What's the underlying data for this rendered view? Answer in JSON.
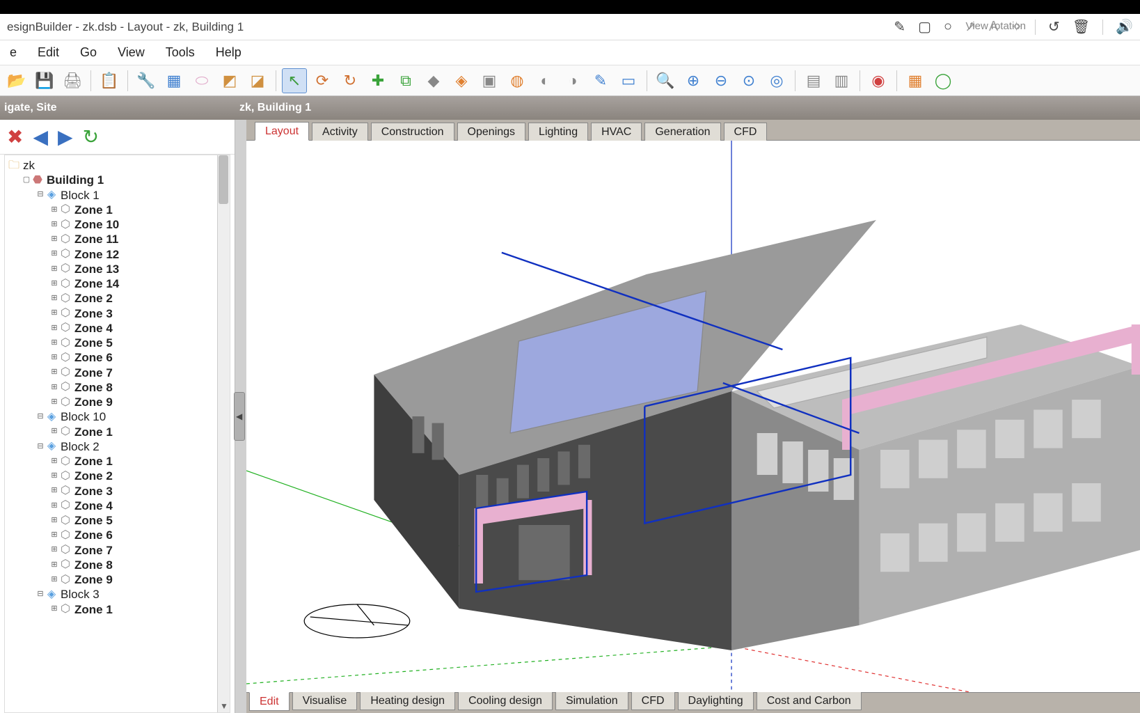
{
  "app": {
    "title_text": "esignBuilder - zk.dsb - Layout - zk, Building 1"
  },
  "menubar": {
    "items": [
      {
        "label": "e"
      },
      {
        "label": "Edit"
      },
      {
        "label": "Go"
      },
      {
        "label": "View"
      },
      {
        "label": "Tools"
      },
      {
        "label": "Help"
      }
    ]
  },
  "title_tools": {
    "items": [
      {
        "glyph": "✎",
        "name": "pencil-icon"
      },
      {
        "glyph": "▢",
        "name": "square-icon"
      },
      {
        "glyph": "○",
        "name": "circle-icon"
      },
      {
        "glyph": "↗",
        "name": "arrow-icon"
      },
      {
        "glyph": "A",
        "name": "text-icon"
      },
      {
        "glyph": "✧",
        "name": "sparkle-icon"
      },
      {
        "glyph": "↺",
        "name": "undo-icon"
      },
      {
        "glyph": "🗑",
        "name": "trash-icon"
      },
      {
        "glyph": "🔊",
        "name": "speaker-icon"
      }
    ]
  },
  "view_hint": {
    "text": "View rotation"
  },
  "toolbar": {
    "buttons": [
      {
        "glyph": "📂",
        "name": "open-icon",
        "cls": "c-folder"
      },
      {
        "glyph": "💾",
        "name": "save-icon",
        "cls": "c-save"
      },
      {
        "glyph": "🖨",
        "name": "print-icon",
        "cls": "c-print"
      },
      {
        "glyph": "sep"
      },
      {
        "glyph": "📋",
        "name": "clipboard-icon",
        "cls": "c-grey"
      },
      {
        "glyph": "sep"
      },
      {
        "glyph": "🔧",
        "name": "wrench-icon",
        "cls": "c-wrench"
      },
      {
        "glyph": "▦",
        "name": "grid-icon",
        "cls": "c-blue"
      },
      {
        "glyph": "⬭",
        "name": "eraser-icon",
        "cls": "c-erase"
      },
      {
        "glyph": "◩",
        "name": "block-add-icon",
        "cls": "c-cube"
      },
      {
        "glyph": "◪",
        "name": "block-dup-icon",
        "cls": "c-cube"
      },
      {
        "glyph": "sep"
      },
      {
        "glyph": "↖",
        "name": "select-icon",
        "cls": "c-pointer",
        "selected": true
      },
      {
        "glyph": "⟳",
        "name": "rotate-icon",
        "cls": "c-roto"
      },
      {
        "glyph": "↻",
        "name": "orbit-icon",
        "cls": "c-roto"
      },
      {
        "glyph": "✚",
        "name": "add-green-icon",
        "cls": "c-green"
      },
      {
        "glyph": "⧉",
        "name": "array-icon",
        "cls": "c-green"
      },
      {
        "glyph": "◆",
        "name": "diamond-icon",
        "cls": "c-grey"
      },
      {
        "glyph": "◈",
        "name": "shade-icon",
        "cls": "c-orange"
      },
      {
        "glyph": "▣",
        "name": "frame-icon",
        "cls": "c-grey"
      },
      {
        "glyph": "◍",
        "name": "cylinder-icon",
        "cls": "c-orange"
      },
      {
        "glyph": "◐",
        "name": "half-icon",
        "cls": "c-grey"
      },
      {
        "glyph": "◑",
        "name": "copyobj-icon",
        "cls": "c-grey"
      },
      {
        "glyph": "✎",
        "name": "edit-icon",
        "cls": "c-blue"
      },
      {
        "glyph": "▭",
        "name": "rect-blue-icon",
        "cls": "c-blue"
      },
      {
        "glyph": "sep"
      },
      {
        "glyph": "🔍",
        "name": "zoom-icon",
        "cls": "c-blue"
      },
      {
        "glyph": "⊕",
        "name": "zoomin-icon",
        "cls": "c-blue"
      },
      {
        "glyph": "⊖",
        "name": "zoomout-icon",
        "cls": "c-blue"
      },
      {
        "glyph": "⊙",
        "name": "zoomfit-icon",
        "cls": "c-blue"
      },
      {
        "glyph": "◎",
        "name": "circletool-icon",
        "cls": "c-blue"
      },
      {
        "glyph": "sep"
      },
      {
        "glyph": "▤",
        "name": "panel1-icon",
        "cls": "c-grey"
      },
      {
        "glyph": "▥",
        "name": "panel2-icon",
        "cls": "c-grey"
      },
      {
        "glyph": "sep"
      },
      {
        "glyph": "◉",
        "name": "target-icon",
        "cls": "c-target"
      },
      {
        "glyph": "sep"
      },
      {
        "glyph": "▦",
        "name": "check-icon",
        "cls": "c-orange"
      },
      {
        "glyph": "◯",
        "name": "lca-icon",
        "cls": "c-green"
      }
    ]
  },
  "section": {
    "left_title": "igate, Site",
    "right_title": "zk, Building 1"
  },
  "sidebar_tools": {
    "items": [
      {
        "glyph": "✖",
        "name": "tree-delete-icon",
        "color": "#d04040"
      },
      {
        "glyph": "◀",
        "name": "tree-back-icon",
        "color": "#3a70c0"
      },
      {
        "glyph": "▶",
        "name": "tree-forward-icon",
        "color": "#3a70c0"
      },
      {
        "glyph": "↻",
        "name": "tree-refresh-icon",
        "color": "#3aa33a"
      }
    ]
  },
  "tree": {
    "root": {
      "label": "zk",
      "indent": 0,
      "bold": false,
      "type": "site",
      "chev": ""
    },
    "items": [
      {
        "label": "Building 1",
        "indent": 1,
        "bold": true,
        "type": "building",
        "chev": "▢"
      },
      {
        "label": "Block 1",
        "indent": 2,
        "bold": false,
        "type": "block",
        "chev": "⊟"
      },
      {
        "label": "Zone 1",
        "indent": 3,
        "bold": true,
        "type": "zone",
        "chev": "⊞"
      },
      {
        "label": "Zone 10",
        "indent": 3,
        "bold": true,
        "type": "zone",
        "chev": "⊞"
      },
      {
        "label": "Zone 11",
        "indent": 3,
        "bold": true,
        "type": "zone",
        "chev": "⊞"
      },
      {
        "label": "Zone 12",
        "indent": 3,
        "bold": true,
        "type": "zone",
        "chev": "⊞"
      },
      {
        "label": "Zone 13",
        "indent": 3,
        "bold": true,
        "type": "zone",
        "chev": "⊞"
      },
      {
        "label": "Zone 14",
        "indent": 3,
        "bold": true,
        "type": "zone",
        "chev": "⊞"
      },
      {
        "label": "Zone 2",
        "indent": 3,
        "bold": true,
        "type": "zone",
        "chev": "⊞"
      },
      {
        "label": "Zone 3",
        "indent": 3,
        "bold": true,
        "type": "zone",
        "chev": "⊞"
      },
      {
        "label": "Zone 4",
        "indent": 3,
        "bold": true,
        "type": "zone",
        "chev": "⊞"
      },
      {
        "label": "Zone 5",
        "indent": 3,
        "bold": true,
        "type": "zone",
        "chev": "⊞"
      },
      {
        "label": "Zone 6",
        "indent": 3,
        "bold": true,
        "type": "zone",
        "chev": "⊞"
      },
      {
        "label": "Zone 7",
        "indent": 3,
        "bold": true,
        "type": "zone",
        "chev": "⊞"
      },
      {
        "label": "Zone 8",
        "indent": 3,
        "bold": true,
        "type": "zone",
        "chev": "⊞"
      },
      {
        "label": "Zone 9",
        "indent": 3,
        "bold": true,
        "type": "zone",
        "chev": "⊞"
      },
      {
        "label": "Block 10",
        "indent": 2,
        "bold": false,
        "type": "block",
        "chev": "⊟"
      },
      {
        "label": "Zone 1",
        "indent": 3,
        "bold": true,
        "type": "zone",
        "chev": "⊞"
      },
      {
        "label": "Block 2",
        "indent": 2,
        "bold": false,
        "type": "block",
        "chev": "⊟"
      },
      {
        "label": "Zone 1",
        "indent": 3,
        "bold": true,
        "type": "zone",
        "chev": "⊞"
      },
      {
        "label": "Zone 2",
        "indent": 3,
        "bold": true,
        "type": "zone",
        "chev": "⊞"
      },
      {
        "label": "Zone 3",
        "indent": 3,
        "bold": true,
        "type": "zone",
        "chev": "⊞"
      },
      {
        "label": "Zone 4",
        "indent": 3,
        "bold": true,
        "type": "zone",
        "chev": "⊞"
      },
      {
        "label": "Zone 5",
        "indent": 3,
        "bold": true,
        "type": "zone",
        "chev": "⊞"
      },
      {
        "label": "Zone 6",
        "indent": 3,
        "bold": true,
        "type": "zone",
        "chev": "⊞"
      },
      {
        "label": "Zone 7",
        "indent": 3,
        "bold": true,
        "type": "zone",
        "chev": "⊞"
      },
      {
        "label": "Zone 8",
        "indent": 3,
        "bold": true,
        "type": "zone",
        "chev": "⊞"
      },
      {
        "label": "Zone 9",
        "indent": 3,
        "bold": true,
        "type": "zone",
        "chev": "⊞"
      },
      {
        "label": "Block 3",
        "indent": 2,
        "bold": false,
        "type": "block",
        "chev": "⊟"
      },
      {
        "label": "Zone 1",
        "indent": 3,
        "bold": true,
        "type": "zone",
        "chev": "⊞"
      }
    ]
  },
  "tabs_top": {
    "items": [
      {
        "label": "Layout",
        "selected": true
      },
      {
        "label": "Activity",
        "selected": false
      },
      {
        "label": "Construction",
        "selected": false
      },
      {
        "label": "Openings",
        "selected": false
      },
      {
        "label": "Lighting",
        "selected": false
      },
      {
        "label": "HVAC",
        "selected": false
      },
      {
        "label": "Generation",
        "selected": false
      },
      {
        "label": "CFD",
        "selected": false
      }
    ]
  },
  "tabs_bottom": {
    "items": [
      {
        "label": "Edit",
        "selected": true
      },
      {
        "label": "Visualise",
        "selected": false
      },
      {
        "label": "Heating design",
        "selected": false
      },
      {
        "label": "Cooling design",
        "selected": false
      },
      {
        "label": "Simulation",
        "selected": false
      },
      {
        "label": "CFD",
        "selected": false
      },
      {
        "label": "Daylighting",
        "selected": false
      },
      {
        "label": "Cost and Carbon",
        "selected": false
      }
    ]
  },
  "colors": {
    "wall_dark": "#4a4a4a",
    "wall_mid": "#6a6a6a",
    "roof_grey": "#9a9a9a",
    "roof_light": "#d6d6d6",
    "window": "#b0b0b0",
    "skylight": "#9da8de",
    "pink": "#e8b0d0",
    "wire_blue": "#1030c0",
    "ground_green": "#20b020",
    "ground_red": "#e03030"
  }
}
